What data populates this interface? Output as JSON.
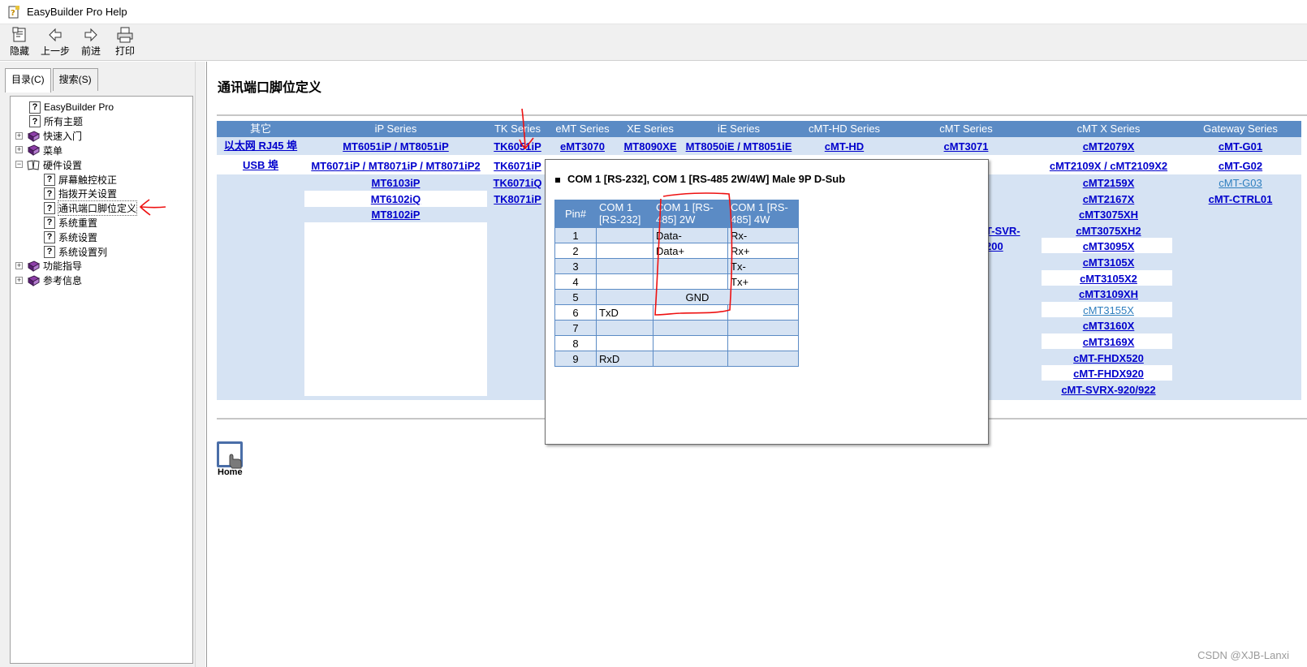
{
  "window": {
    "title": "EasyBuilder Pro Help"
  },
  "toolbar": [
    {
      "label": "隐藏",
      "icon": "hide-icon"
    },
    {
      "label": "上一步",
      "icon": "back-arrow-icon"
    },
    {
      "label": "前进",
      "icon": "forward-arrow-icon"
    },
    {
      "label": "打印",
      "icon": "printer-icon"
    }
  ],
  "tabs": [
    {
      "label": "目录(C)",
      "active": true
    },
    {
      "label": "搜索(S)",
      "active": false
    }
  ],
  "tree": [
    {
      "label": "EasyBuilder Pro",
      "type": "page",
      "level": 1
    },
    {
      "label": "所有主题",
      "type": "page",
      "level": 1
    },
    {
      "label": "快速入门",
      "type": "book",
      "level": 0,
      "expander": "+"
    },
    {
      "label": "菜单",
      "type": "book",
      "level": 0,
      "expander": "+"
    },
    {
      "label": "硬件设置",
      "type": "openbook",
      "level": 0,
      "expander": "−"
    },
    {
      "label": "屏幕触控校正",
      "type": "page",
      "level": 2
    },
    {
      "label": "指拨开关设置",
      "type": "page",
      "level": 2
    },
    {
      "label": "通讯端口脚位定义",
      "type": "page",
      "level": 2,
      "selected": true
    },
    {
      "label": "系统重置",
      "type": "page",
      "level": 2
    },
    {
      "label": "系统设置",
      "type": "page",
      "level": 2
    },
    {
      "label": "系统设置列",
      "type": "page",
      "level": 2
    },
    {
      "label": "功能指导",
      "type": "book",
      "level": 0,
      "expander": "+"
    },
    {
      "label": "参考信息",
      "type": "book",
      "level": 0,
      "expander": "+"
    }
  ],
  "page": {
    "title": "通讯端口脚位定义",
    "headers": [
      "其它",
      "iP Series",
      "TK Series",
      "eMT Series",
      "XE Series",
      "iE Series",
      "cMT-HD Series",
      "cMT Series",
      "cMT  X Series",
      "Gateway Series"
    ],
    "row_ethernet": {
      "label": "以太网 RJ45 埠",
      "ip": "MT6051iP / MT8051iP",
      "tk": "TK6051iP",
      "emt": "eMT3070",
      "xe": "MT8090XE",
      "ie": "MT8050iE / MT8051iE",
      "cmthd": "cMT-HD",
      "cmt": "cMT3071",
      "cmtx": "cMT2079X",
      "gateway": "cMT-G01"
    },
    "row_usb": {
      "label": "USB 埠",
      "ip": "MT6071iP / MT8071iP / MT8071iP2",
      "tk": "TK6071iP",
      "cmtx": "cMT2109X / cMT2109X2",
      "gateway": "cMT-G02"
    },
    "ip_extra": [
      "MT6103iP",
      "MT6102iQ",
      "MT8102iP"
    ],
    "tk_extra": [
      "TK6071iQ",
      "TK8071iP"
    ],
    "cmt_partial": [
      "T-SVR-200",
      "."
    ],
    "cmtx_extra": [
      "cMT2159X",
      "cMT2167X",
      "cMT3075XH",
      "cMT3075XH2",
      "cMT3095X",
      "cMT3105X",
      "cMT3105X2",
      "cMT3109XH",
      "cMT3155X",
      "cMT3160X",
      "cMT3169X",
      "cMT-FHDX520",
      "cMT-FHDX920",
      "cMT-SVRX-920/922"
    ],
    "gateway_extra": [
      "cMT-G03",
      "cMT-CTRL01"
    ],
    "home_label": "Home"
  },
  "popup": {
    "title": "COM 1 [RS-232], COM 1 [RS-485 2W/4W] Male 9P D-Sub",
    "columns": [
      "Pin#",
      "COM 1 [RS-232]",
      "COM 1 [RS-485] 2W",
      "COM 1 [RS-485] 4W"
    ],
    "rows": [
      {
        "pin": "1",
        "rs232": "",
        "rs485_2w": "Data-",
        "rs485_4w": "Rx-"
      },
      {
        "pin": "2",
        "rs232": "",
        "rs485_2w": "Data+",
        "rs485_4w": "Rx+"
      },
      {
        "pin": "3",
        "rs232": "",
        "rs485_2w": "",
        "rs485_4w": "Tx-"
      },
      {
        "pin": "4",
        "rs232": "",
        "rs485_2w": "",
        "rs485_4w": "Tx+"
      },
      {
        "pin": "5",
        "shared": "GND"
      },
      {
        "pin": "6",
        "rs232": "TxD",
        "rs485_2w": "",
        "rs485_4w": ""
      },
      {
        "pin": "7",
        "rs232": "",
        "rs485_2w": "",
        "rs485_4w": ""
      },
      {
        "pin": "8",
        "rs232": "",
        "rs485_2w": "",
        "rs485_4w": ""
      },
      {
        "pin": "9",
        "rs232": "RxD",
        "rs485_2w": "",
        "rs485_4w": ""
      }
    ]
  },
  "watermark": "CSDN @XJB-Lanxi",
  "colors": {
    "header_blue": "#5b8bc5",
    "band_blue": "#d6e3f3",
    "link": "#0000cc",
    "annotation_red": "#ee1111"
  }
}
